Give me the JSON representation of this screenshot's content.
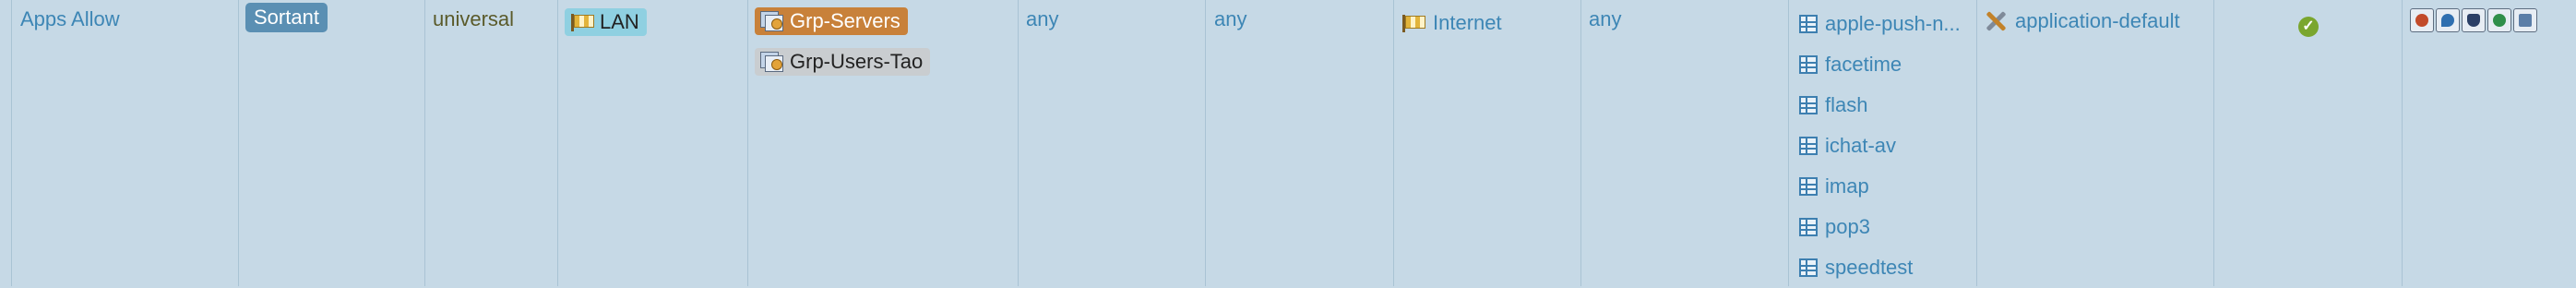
{
  "rule": {
    "name": "Apps Allow",
    "tag": "Sortant",
    "type": "universal",
    "source_zone": {
      "label": "LAN",
      "icon": "zone-flag-icon"
    },
    "source_addresses": [
      {
        "label": "Grp-Servers",
        "icon": "address-group-icon"
      },
      {
        "label": "Grp-Users-Tao",
        "icon": "address-group-icon"
      }
    ],
    "source_user": "any",
    "source_device": "any",
    "destination_zone": {
      "label": "Internet",
      "icon": "zone-flag-icon"
    },
    "destination_address": "any",
    "applications": [
      "apple-push-n...",
      "facetime",
      "flash",
      "ichat-av",
      "imap",
      "pop3",
      "speedtest"
    ],
    "service": {
      "label": "application-default",
      "icon": "wrench-icon"
    },
    "action": "allow-check-icon",
    "profile_icons": [
      "antivirus-profile-icon",
      "url-filtering-profile-icon",
      "vulnerability-profile-icon",
      "wildfire-profile-icon",
      "file-blocking-profile-icon"
    ]
  },
  "colors": {
    "row_background": "#c6d9e6",
    "link": "#3d86b5",
    "tag_background": "#5a8fb3",
    "zone_chip": "#8fd0e1",
    "group_chip_selected": "#c8813a",
    "group_chip": "#c9cdd0"
  }
}
